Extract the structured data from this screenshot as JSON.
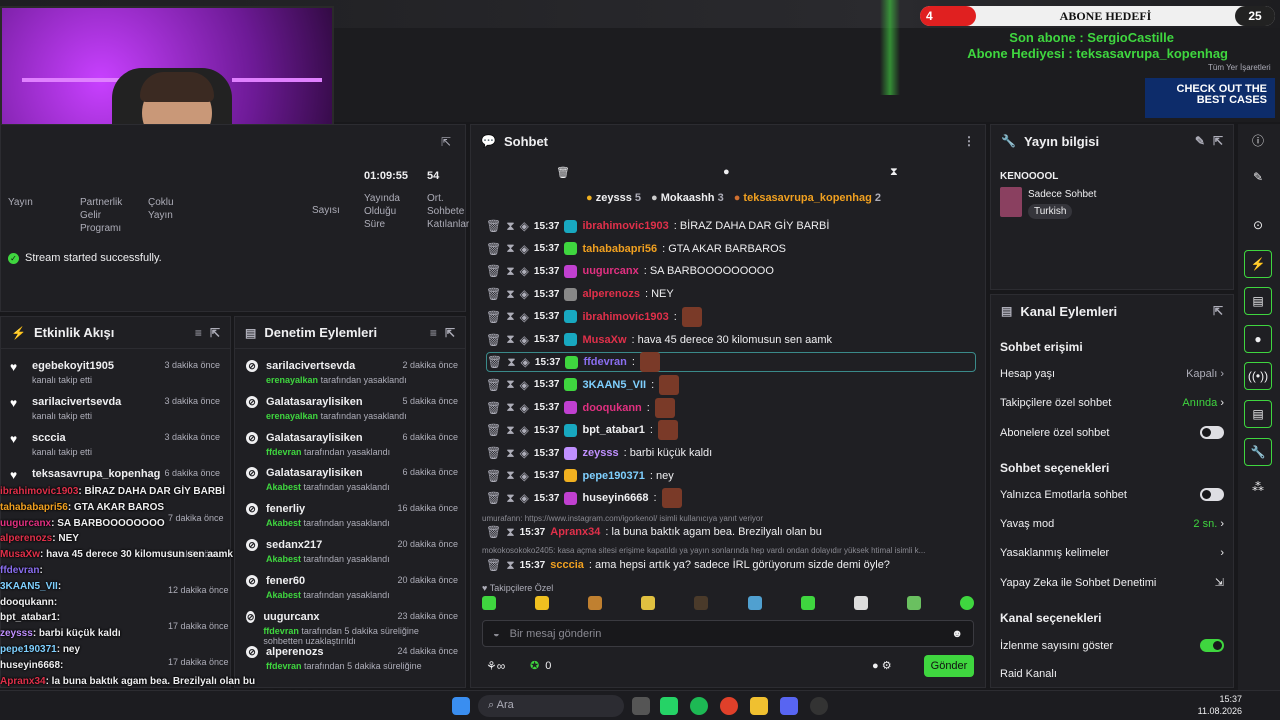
{
  "overlay_top": {
    "goal_left": "4",
    "goal_title": "ABONE HEDEFİ",
    "goal_right": "25",
    "sub_line1": "Son abone : SergioCastille",
    "sub_line2": "Abone Hediyesi : teksasavrupa_kopenhag",
    "promo": "CHECK OUT THE BEST CASES",
    "bookmarks": "Tüm Yer İşaretleri"
  },
  "stats": {
    "duration": "01:09:55",
    "followers_count": "54",
    "labels": [
      "Yayın",
      "Partnerlik Gelir Programı",
      "Çoklu Yayın",
      "Yayında Olduğu Süre",
      "Ort. Sohbete Katılanlar",
      "Sayısı"
    ]
  },
  "status": "Stream started successfully.",
  "activity": {
    "title": "Etkinlik Akışı",
    "items": [
      {
        "name": "egebekoyit1905",
        "sub": "kanalı takip etti",
        "time": "3 dakika önce"
      },
      {
        "name": "sarilacivertsevda",
        "sub": "kanalı takip etti",
        "time": "3 dakika önce"
      },
      {
        "name": "scccia",
        "sub": "kanalı takip etti",
        "time": "3 dakika önce"
      },
      {
        "name": "teksasavrupa_kopenhag",
        "sub": "",
        "time": "6 dakika önce"
      }
    ],
    "extra_times": [
      "7 dakika önce",
      "9 dakika önce",
      "12 dakika önce",
      "17 dakika önce",
      "17 dakika önce"
    ]
  },
  "mod": {
    "title": "Denetim Eylemleri",
    "items": [
      {
        "name": "sarilacivertsevda",
        "by": "erenayalkan",
        "rest": "tarafından yasaklandı",
        "time": "2 dakika önce"
      },
      {
        "name": "Galatasaraylisiken",
        "by": "erenayalkan",
        "rest": "tarafından yasaklandı",
        "time": "5 dakika önce"
      },
      {
        "name": "Galatasaraylisiken",
        "by": "ffdevran",
        "rest": "tarafından yasaklandı",
        "time": "6 dakika önce"
      },
      {
        "name": "Galatasaraylisiken",
        "by": "Akabest",
        "rest": "tarafından yasaklandı",
        "time": "6 dakika önce"
      },
      {
        "name": "fenerliy",
        "by": "Akabest",
        "rest": "tarafından yasaklandı",
        "time": "16 dakika önce"
      },
      {
        "name": "sedanx217",
        "by": "Akabest",
        "rest": "tarafından yasaklandı",
        "time": "20 dakika önce"
      },
      {
        "name": "fener60",
        "by": "Akabest",
        "rest": "tarafından yasaklandı",
        "time": "20 dakika önce"
      },
      {
        "name": "uugurcanx",
        "by": "ffdevran",
        "rest": "tarafından 5 dakika süreliğine sohbetten uzaklaştırıldı",
        "time": "23 dakika önce"
      },
      {
        "name": "alperenozs",
        "by": "ffdevran",
        "rest": "tarafından 5 dakika süreliğine",
        "time": "24 dakika önce"
      }
    ]
  },
  "overlay_chat": [
    {
      "u": "ibrahimovic1903",
      "c": "#e0304a",
      "m": ": BİRAZ DAHA DAR GİY BARBİ"
    },
    {
      "u": "tahababapri56",
      "c": "#f0a020",
      "m": ": GTA AKAR BAROS"
    },
    {
      "u": "uugurcanx",
      "c": "#e03080",
      "m": ": SA BARBOOOOOOOO"
    },
    {
      "u": "alperenozs",
      "c": "#e0304a",
      "m": ": NEY"
    },
    {
      "u": "",
      "c": "#e0304a",
      "m": ""
    },
    {
      "u": "MusaXw",
      "c": "#e0304a",
      "m": ": hava 45 derece 30 kilomusun sen aamk"
    },
    {
      "u": "ffdevran",
      "c": "#8a6ef0",
      "m": ": "
    },
    {
      "u": "3KAAN5_VII",
      "c": "#7fd0ff",
      "m": ": "
    },
    {
      "u": "dooqukann",
      "c": "#efeff1",
      "m": ": "
    },
    {
      "u": "bpt_atabar1",
      "c": "#efeff1",
      "m": ": "
    },
    {
      "u": "zeysss",
      "c": "#c090ff",
      "m": ": barbi küçük kaldı"
    },
    {
      "u": "pepe190371",
      "c": "#7fd0ff",
      "m": ": ney"
    },
    {
      "u": "huseyin6668",
      "c": "#efeff1",
      "m": ": "
    },
    {
      "u": "Apranx34",
      "c": "#e0304a",
      "m": ": la buna baktık agam bea. Brezilyalı olan bu"
    },
    {
      "u": "scccia",
      "c": "#efeff1",
      "m": ": ama hepsi artık ya? sadece İRL görüyorum sizde demi öyle?"
    }
  ],
  "chat": {
    "title": "Sohbet",
    "leaders": [
      {
        "n": "zeysss",
        "v": "5"
      },
      {
        "n": "Mokaashh",
        "v": "3"
      },
      {
        "n": "teksasavrupa_kopenhag",
        "v": "2"
      }
    ],
    "messages": [
      {
        "time": "15:37",
        "user": "ibrahimovic1903",
        "color": "#e0304a",
        "text": ": BİRAZ DAHA DAR GİY BARBİ"
      },
      {
        "time": "15:37",
        "user": "tahababapri56",
        "color": "#f0a020",
        "text": ": GTA AKAR BARBAROS"
      },
      {
        "time": "15:37",
        "user": "uugurcanx",
        "color": "#e03080",
        "text": ": SA BARBOOOOOOOOO"
      },
      {
        "time": "15:37",
        "user": "alperenozs",
        "color": "#e0304a",
        "text": ": NEY"
      },
      {
        "time": "15:37",
        "user": "ibrahimovic1903",
        "color": "#e0304a",
        "text": ":"
      },
      {
        "time": "15:37",
        "user": "MusaXw",
        "color": "#e0304a",
        "text": ": hava 45 derece 30 kilomusun sen aamk"
      },
      {
        "time": "15:37",
        "user": "ffdevran",
        "color": "#8a6ef0",
        "text": ":"
      },
      {
        "time": "15:37",
        "user": "3KAAN5_VII",
        "color": "#7fd0ff",
        "text": ":"
      },
      {
        "time": "15:37",
        "user": "dooqukann",
        "color": "#e03080",
        "text": ":"
      },
      {
        "time": "15:37",
        "user": "bpt_atabar1",
        "color": "#efeff1",
        "text": ":"
      },
      {
        "time": "15:37",
        "user": "zeysss",
        "color": "#c090ff",
        "text": ": barbi küçük kaldı"
      },
      {
        "time": "15:37",
        "user": "pepe190371",
        "color": "#7fd0ff",
        "text": ": ney"
      },
      {
        "time": "15:37",
        "user": "huseyin6668",
        "color": "#efeff1",
        "text": ":"
      }
    ],
    "reply1": "umurafann: https://www.instagram.com/igorkenol/ isimli kullanıcıya yanıt veriyor",
    "m14": {
      "time": "15:37",
      "user": "Apranx34",
      "color": "#e0304a",
      "text": ": la buna baktık agam bea. Brezilyalı olan bu"
    },
    "reply2": "mokokosokoko2405: kasa açma sitesi erişime kapatıldı ya yayın sonlarında hep vardı ondan dolayıdır yüksek htimal isimli k...",
    "m15": {
      "time": "15:37",
      "user": "scccia",
      "color": "#f0a020",
      "text": ": ama hepsi artık ya? sadece İRL görüyorum sizde demi öyle?"
    },
    "followers_label": "Takipçilere Özel",
    "placeholder": "Bir mesaj gönderin",
    "send": "Gönder",
    "count": "0"
  },
  "info": {
    "title": "Yayın bilgisi",
    "channel": "KENOOOOL",
    "category": "Sadece Sohbet",
    "tag": "Turkish"
  },
  "actions": {
    "title": "Kanal Eylemleri",
    "sec1": "Sohbet erişimi",
    "rows1": [
      {
        "l": "Hesap yaşı",
        "v": "Kapalı"
      },
      {
        "l": "Takipçilere özel sohbet",
        "v": "Anında"
      },
      {
        "l": "Abonelere özel sohbet",
        "v": ""
      }
    ],
    "sec2": "Sohbet seçenekleri",
    "rows2": [
      {
        "l": "Yalnızca Emotlarla sohbet",
        "v": ""
      },
      {
        "l": "Yavaş mod",
        "v": "2 sn."
      },
      {
        "l": "Yasaklanmış kelimeler",
        "v": ""
      },
      {
        "l": "Yapay Zeka ile Sohbet Denetimi",
        "v": ""
      }
    ],
    "sec3": "Kanal seçenekleri",
    "rows3": [
      {
        "l": "İzlenme sayısını göster",
        "v": ""
      },
      {
        "l": "Raid Kanalı",
        "v": ""
      }
    ]
  },
  "taskbar": {
    "search": "Ara",
    "time": "15:37",
    "date": "11.08.2026"
  }
}
